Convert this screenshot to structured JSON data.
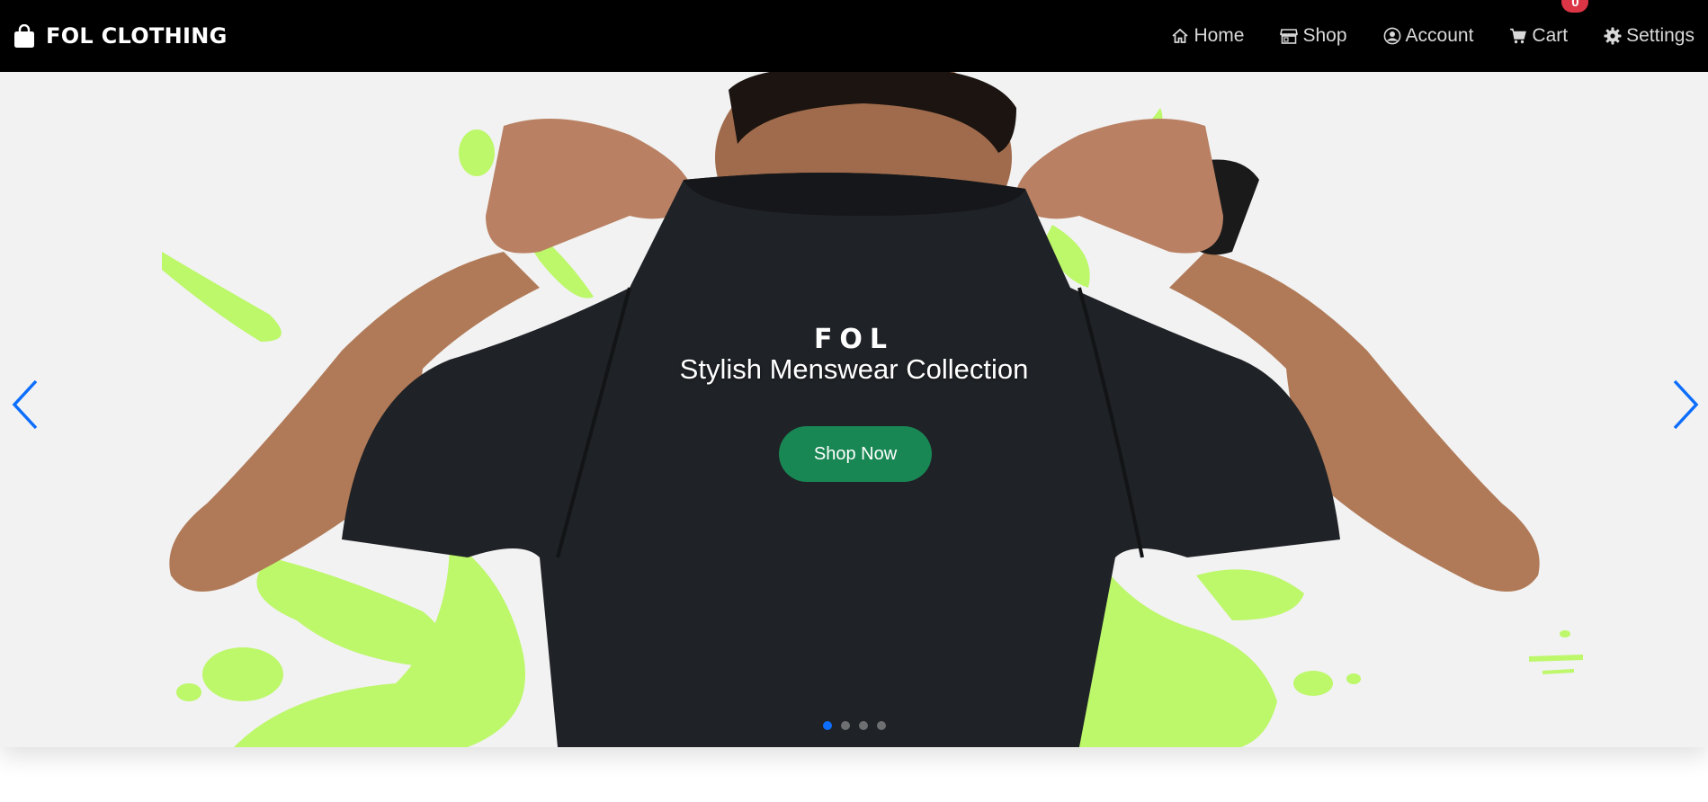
{
  "navbar": {
    "brand": "FOL CLOTHING",
    "items": [
      {
        "label": "Home",
        "icon": "home-icon"
      },
      {
        "label": "Shop",
        "icon": "store-icon"
      },
      {
        "label": "Account",
        "icon": "user-circle-icon"
      },
      {
        "label": "Cart",
        "icon": "cart-icon"
      },
      {
        "label": "Settings",
        "icon": "gear-icon"
      }
    ],
    "cart_count": "0"
  },
  "hero": {
    "shirt_logo": "FOL",
    "caption": "Stylish Menswear Collection",
    "cta_label": "Shop Now",
    "slide_count": 4,
    "active_slide": 0
  },
  "colors": {
    "navbar_bg": "#000000",
    "cta_green": "#198754",
    "badge_red": "#dc3545",
    "accent_blue": "#0d6efd",
    "splash_green": "#bdf76a"
  }
}
